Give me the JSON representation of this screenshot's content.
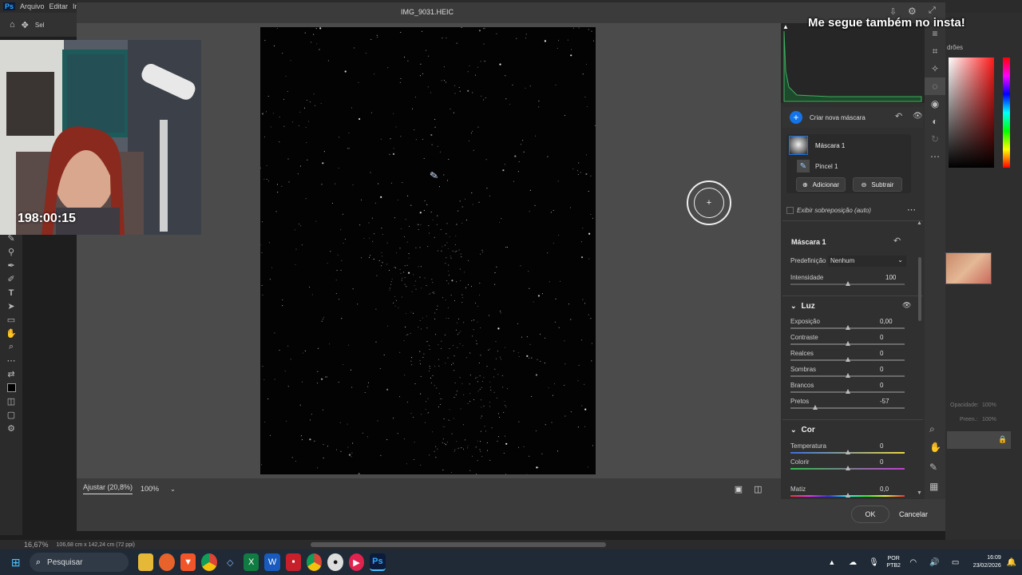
{
  "ps": {
    "menu": [
      "Arquivo",
      "Editar",
      "Im"
    ],
    "logo": "Ps",
    "options_label": "Sel",
    "status_zoom": "16,67%",
    "status_doc": "106,68 cm x 142,24 cm (72 ppi)",
    "right_panel_label": "drões",
    "opacity_label": "Opacidade:",
    "opacity_value": "100%",
    "fill_label": "Preen.:",
    "fill_value": "100%"
  },
  "overlay": {
    "timer": "198:00:15",
    "insta_text": "Me segue também no insta!"
  },
  "dialog": {
    "title": "IMG_9031.HEIC",
    "fit_label": "Ajustar (20,8%)",
    "zoom_label": "100%",
    "ok_label": "OK",
    "cancel_label": "Cancelar"
  },
  "masking": {
    "create_label": "Criar nova máscara",
    "mask_name": "Máscara 1",
    "brush_name": "Pincel 1",
    "add_label": "Adicionar",
    "subtract_label": "Subtrair",
    "overlay_label": "Exibir sobreposição (auto)",
    "panel_title": "Máscara 1",
    "preset_label": "Predefinição",
    "preset_value": "Nenhum",
    "intensity_label": "Intensidade",
    "intensity_value": "100"
  },
  "light": {
    "title": "Luz",
    "sliders": [
      {
        "label": "Exposição",
        "value": "0,00",
        "pos": 0.5
      },
      {
        "label": "Contraste",
        "value": "0",
        "pos": 0.5
      },
      {
        "label": "Realces",
        "value": "0",
        "pos": 0.5
      },
      {
        "label": "Sombras",
        "value": "0",
        "pos": 0.5
      },
      {
        "label": "Brancos",
        "value": "0",
        "pos": 0.5
      },
      {
        "label": "Pretos",
        "value": "-57",
        "pos": 0.215
      }
    ]
  },
  "color": {
    "title": "Cor",
    "sliders": [
      {
        "label": "Temperatura",
        "value": "0",
        "pos": 0.5
      },
      {
        "label": "Colorir",
        "value": "0",
        "pos": 0.5
      },
      {
        "label": "Matiz",
        "value": "0,0",
        "pos": 0.5
      }
    ]
  },
  "taskbar": {
    "search_placeholder": "Pesquisar",
    "lang1": "POR",
    "lang2": "PTB2",
    "time": "16:09",
    "date": "23/02/2026"
  }
}
